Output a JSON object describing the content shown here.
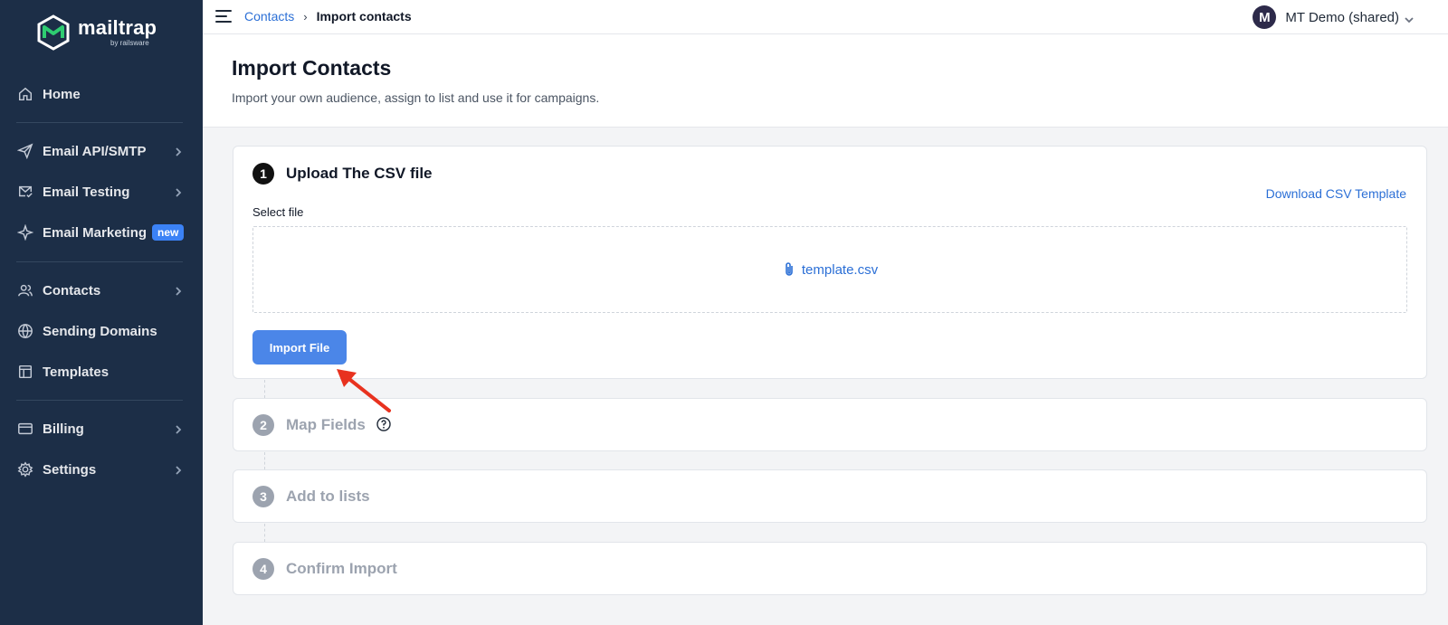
{
  "brand": {
    "name": "mailtrap",
    "byline": "by railsware",
    "accent": "#2ecc71"
  },
  "sidebar": {
    "items": [
      {
        "label": "Home",
        "icon": "home-icon"
      },
      {
        "label": "Email API/SMTP",
        "icon": "send-icon",
        "has_submenu": true
      },
      {
        "label": "Email Testing",
        "icon": "mail-check-icon",
        "has_submenu": true
      },
      {
        "label": "Email Marketing",
        "icon": "sparkle-icon",
        "badge": "new"
      },
      {
        "label": "Contacts",
        "icon": "users-icon",
        "has_submenu": true
      },
      {
        "label": "Sending Domains",
        "icon": "globe-icon"
      },
      {
        "label": "Templates",
        "icon": "layout-icon"
      },
      {
        "label": "Billing",
        "icon": "credit-card-icon",
        "has_submenu": true
      },
      {
        "label": "Settings",
        "icon": "gear-icon",
        "has_submenu": true
      }
    ]
  },
  "topbar": {
    "breadcrumb": {
      "parent": "Contacts",
      "separator": "›",
      "current": "Import contacts"
    },
    "account": {
      "avatar_initial": "M",
      "name": "MT Demo (shared)"
    }
  },
  "header": {
    "title": "Import Contacts",
    "subtitle": "Import your own audience, assign to list and use it for campaigns."
  },
  "steps": [
    {
      "number": "1",
      "title": "Upload The CSV file",
      "active": true,
      "download_link": "Download CSV Template",
      "select_label": "Select file",
      "file_name": "template.csv",
      "button_label": "Import File"
    },
    {
      "number": "2",
      "title": "Map Fields",
      "active": false,
      "has_help": true
    },
    {
      "number": "3",
      "title": "Add to lists",
      "active": false
    },
    {
      "number": "4",
      "title": "Confirm Import",
      "active": false
    }
  ],
  "colors": {
    "sidebar_bg": "#1c2e47",
    "link": "#2b6fd6",
    "primary_button": "#4b86e8",
    "annotation_arrow": "#e8321f"
  }
}
